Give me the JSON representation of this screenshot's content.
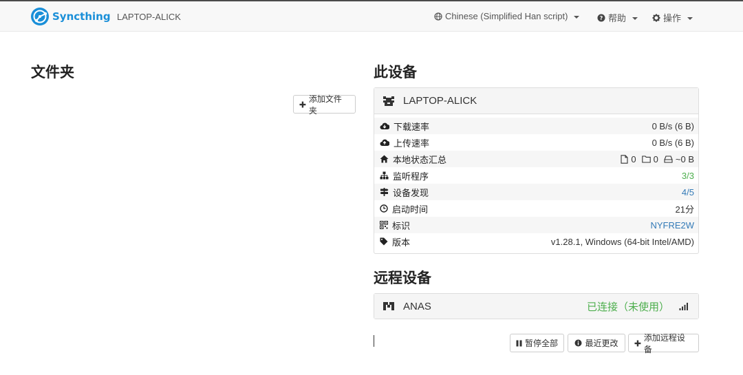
{
  "navbar": {
    "brand": "Syncthing",
    "device_name": "LAPTOP-ALICK",
    "language": "Chinese (Simplified Han script)",
    "help": "帮助",
    "actions": "操作"
  },
  "folders": {
    "title": "文件夹",
    "add_button": "添加文件夹"
  },
  "this_device": {
    "title": "此设备",
    "name": "LAPTOP-ALICK",
    "rows": [
      {
        "label": "下载速率",
        "value": "0 B/s (6 B)",
        "icon": "cloud-download-icon"
      },
      {
        "label": "上传速率",
        "value": "0 B/s (6 B)",
        "icon": "cloud-upload-icon"
      },
      {
        "label": "本地状态汇总",
        "icon": "home-icon",
        "files": "0",
        "dirs": "0",
        "size": "~0 B"
      },
      {
        "label": "监听程序",
        "value": "3/3",
        "icon": "sitemap-icon"
      },
      {
        "label": "设备发现",
        "value": "4/5",
        "icon": "signpost-icon"
      },
      {
        "label": "启动时间",
        "value": "21分",
        "icon": "clock-icon"
      },
      {
        "label": "标识",
        "value": "NYFRE2W",
        "icon": "qrcode-icon"
      },
      {
        "label": "版本",
        "value": "v1.28.1, Windows (64-bit Intel/AMD)",
        "icon": "tag-icon"
      }
    ]
  },
  "remote_devices": {
    "title": "远程设备",
    "devices": [
      {
        "name": "ANAS",
        "status": "已连接（未使用）"
      }
    ]
  },
  "bottom_buttons": {
    "pause_all": "暂停全部",
    "recent_changes": "最近更改",
    "add_remote": "添加远程设备"
  },
  "colors": {
    "brand": "#1a8fd8",
    "success": "#4cae4c",
    "link": "#337ab7"
  }
}
